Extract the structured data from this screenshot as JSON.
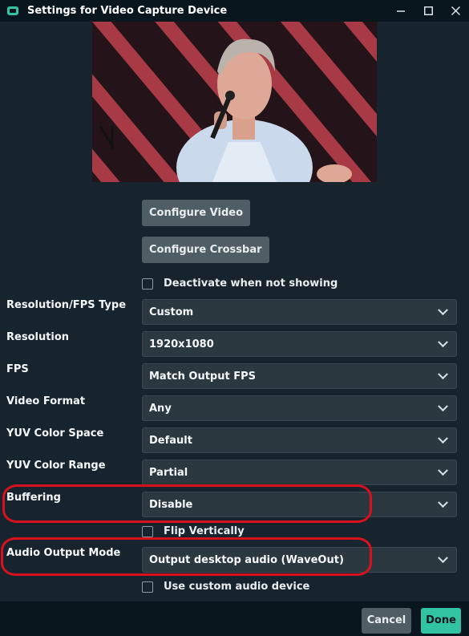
{
  "window": {
    "title": "Settings for Video Capture Device",
    "controls": [
      "minimize-icon",
      "maximize-icon",
      "close-icon"
    ]
  },
  "buttons": {
    "configure_video": "Configure Video",
    "configure_crossbar": "Configure Crossbar"
  },
  "checkboxes": {
    "deactivate": {
      "label": "Deactivate when not showing",
      "checked": false
    },
    "flip": {
      "label": "Flip Vertically",
      "checked": false
    },
    "custom_audio": {
      "label": "Use custom audio device",
      "checked": false
    }
  },
  "fields": {
    "resolution_fps_type": {
      "label": "Resolution/FPS Type",
      "value": "Custom"
    },
    "resolution": {
      "label": "Resolution",
      "value": "1920x1080"
    },
    "fps": {
      "label": "FPS",
      "value": "Match Output FPS"
    },
    "video_format": {
      "label": "Video Format",
      "value": "Any"
    },
    "yuv_color_space": {
      "label": "YUV Color Space",
      "value": "Default"
    },
    "yuv_color_range": {
      "label": "YUV Color Range",
      "value": "Partial"
    },
    "buffering": {
      "label": "Buffering",
      "value": "Disable"
    },
    "audio_output_mode": {
      "label": "Audio Output Mode",
      "value": "Output desktop audio (WaveOut)"
    }
  },
  "footer": {
    "cancel": "Cancel",
    "done": "Done"
  },
  "colors": {
    "background": "#17242d",
    "titlebar": "#09161d",
    "accent": "#31c3a2",
    "highlight": "#d8111e"
  }
}
